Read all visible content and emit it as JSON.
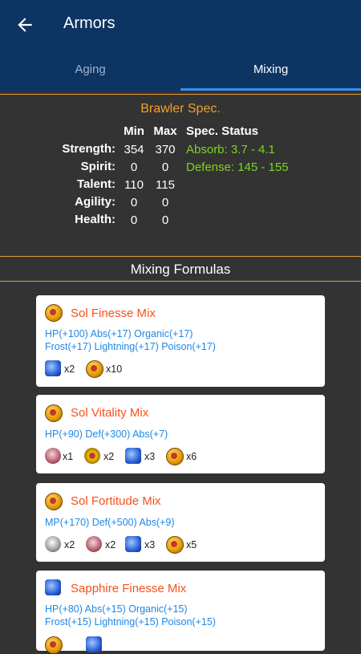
{
  "header": {
    "title": "Armors"
  },
  "tabs": [
    {
      "label": "Aging"
    },
    {
      "label": "Mixing"
    }
  ],
  "spec": {
    "title": "Brawler Spec.",
    "col_min": "Min",
    "col_max": "Max",
    "col_status": "Spec. Status",
    "stats": [
      {
        "name": "Strength:",
        "min": "354",
        "max": "370"
      },
      {
        "name": "Spirit:",
        "min": "0",
        "max": "0"
      },
      {
        "name": "Talent:",
        "min": "110",
        "max": "115"
      },
      {
        "name": "Agility:",
        "min": "0",
        "max": "0"
      },
      {
        "name": "Health:",
        "min": "0",
        "max": "0"
      }
    ],
    "status": [
      "Absorb: 3.7 - 4.1",
      "Defense: 145 - 155"
    ]
  },
  "section_title": "Mixing Formulas",
  "formulas": [
    {
      "name": "Sol Finesse Mix",
      "line1": "HP(+100) Abs(+17) Organic(+17)",
      "line2": "Frost(+17) Lightning(+17) Poison(+17)",
      "ingredients": [
        {
          "icon": "sapphire-icon",
          "qty": "x2"
        },
        {
          "icon": "sol-coin-icon",
          "qty": "x10"
        }
      ]
    },
    {
      "name": "Sol Vitality Mix",
      "line1": "HP(+90) Def(+300) Abs(+7)",
      "ingredients": [
        {
          "icon": "skull-icon",
          "qty": "x1"
        },
        {
          "icon": "ornate-medallion-icon",
          "qty": "x2"
        },
        {
          "icon": "sapphire-icon",
          "qty": "x3"
        },
        {
          "icon": "sol-coin-icon",
          "qty": "x6"
        }
      ]
    },
    {
      "name": "Sol Fortitude Mix",
      "line1": "MP(+170) Def(+500) Abs(+9)",
      "ingredients": [
        {
          "icon": "silver-sphere-icon",
          "qty": "x2"
        },
        {
          "icon": "skull-icon",
          "qty": "x2"
        },
        {
          "icon": "sapphire-icon",
          "qty": "x3"
        },
        {
          "icon": "sol-coin-icon",
          "qty": "x5"
        }
      ]
    },
    {
      "name": "Sapphire Finesse Mix",
      "line1": "HP(+80) Abs(+15) Organic(+15)",
      "line2": "Frost(+15) Lightning(+15) Poison(+15)"
    }
  ]
}
